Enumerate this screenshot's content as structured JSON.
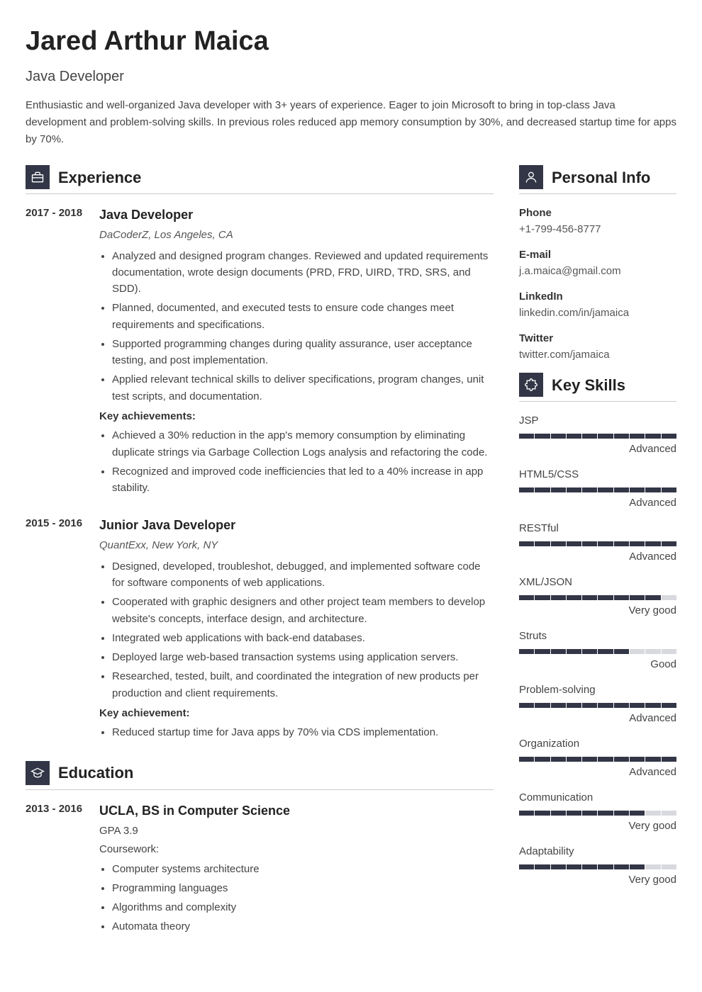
{
  "name": "Jared Arthur Maica",
  "title": "Java Developer",
  "summary": "Enthusiastic and well-organized Java developer with 3+ years of experience. Eager to join Microsoft to bring in top-class Java development and problem-solving skills. In previous roles reduced app memory consumption by 30%, and decreased startup time for apps by 70%.",
  "sections": {
    "experience": "Experience",
    "education": "Education",
    "personal": "Personal Info",
    "skills": "Key Skills"
  },
  "experience": [
    {
      "period": "2017 - 2018",
      "role": "Java Developer",
      "company": "DaCoderZ, Los Angeles, CA",
      "bullets": [
        "Analyzed and designed program changes. Reviewed and updated requirements documentation, wrote design documents (PRD, FRD, UIRD, TRD, SRS, and SDD).",
        "Planned, documented, and executed tests to ensure code changes meet requirements and specifications.",
        "Supported programming changes during quality assurance, user acceptance testing, and post implementation.",
        "Applied relevant technical skills to deliver specifications, program changes, unit test scripts, and documentation."
      ],
      "achLabel": "Key achievements:",
      "achievements": [
        "Achieved a 30% reduction in the app's memory consumption by eliminating duplicate strings via Garbage Collection Logs analysis and refactoring the code.",
        "Recognized and improved code inefficiencies that led to a 40% increase in app stability."
      ]
    },
    {
      "period": "2015 - 2016",
      "role": "Junior Java Developer",
      "company": "QuantExx, New York, NY",
      "bullets": [
        "Designed, developed, troubleshot, debugged, and implemented software code for software components of web applications.",
        "Cooperated with graphic designers and other project team members to develop website's concepts, interface design, and architecture.",
        "Integrated web applications with back-end databases.",
        "Deployed large web-based transaction systems using application servers.",
        "Researched, tested, built, and coordinated the integration of new products per production and client requirements."
      ],
      "achLabel": "Key achievement:",
      "achievements": [
        "Reduced startup time for Java apps by 70% via CDS implementation."
      ]
    }
  ],
  "education": [
    {
      "period": "2013 - 2016",
      "role": "UCLA, BS in Computer Science",
      "gpa": "GPA 3.9",
      "courseLabel": "Coursework:",
      "courses": [
        "Computer systems architecture",
        "Programming languages",
        "Algorithms and complexity",
        "Automata theory"
      ]
    }
  ],
  "personal": {
    "phone": {
      "label": "Phone",
      "value": "+1-799-456-8777"
    },
    "email": {
      "label": "E-mail",
      "value": "j.a.maica@gmail.com"
    },
    "linkedin": {
      "label": "LinkedIn",
      "value": "linkedin.com/in/jamaica"
    },
    "twitter": {
      "label": "Twitter",
      "value": "twitter.com/jamaica"
    }
  },
  "skills": [
    {
      "name": "JSP",
      "level": "Advanced",
      "segments": 10
    },
    {
      "name": "HTML5/CSS",
      "level": "Advanced",
      "segments": 10
    },
    {
      "name": "RESTful",
      "level": "Advanced",
      "segments": 10
    },
    {
      "name": "XML/JSON",
      "level": "Very good",
      "segments": 9
    },
    {
      "name": "Struts",
      "level": "Good",
      "segments": 7
    },
    {
      "name": "Problem-solving",
      "level": "Advanced",
      "segments": 10
    },
    {
      "name": "Organization",
      "level": "Advanced",
      "segments": 10
    },
    {
      "name": "Communication",
      "level": "Very good",
      "segments": 8
    },
    {
      "name": "Adaptability",
      "level": "Very good",
      "segments": 8
    }
  ]
}
